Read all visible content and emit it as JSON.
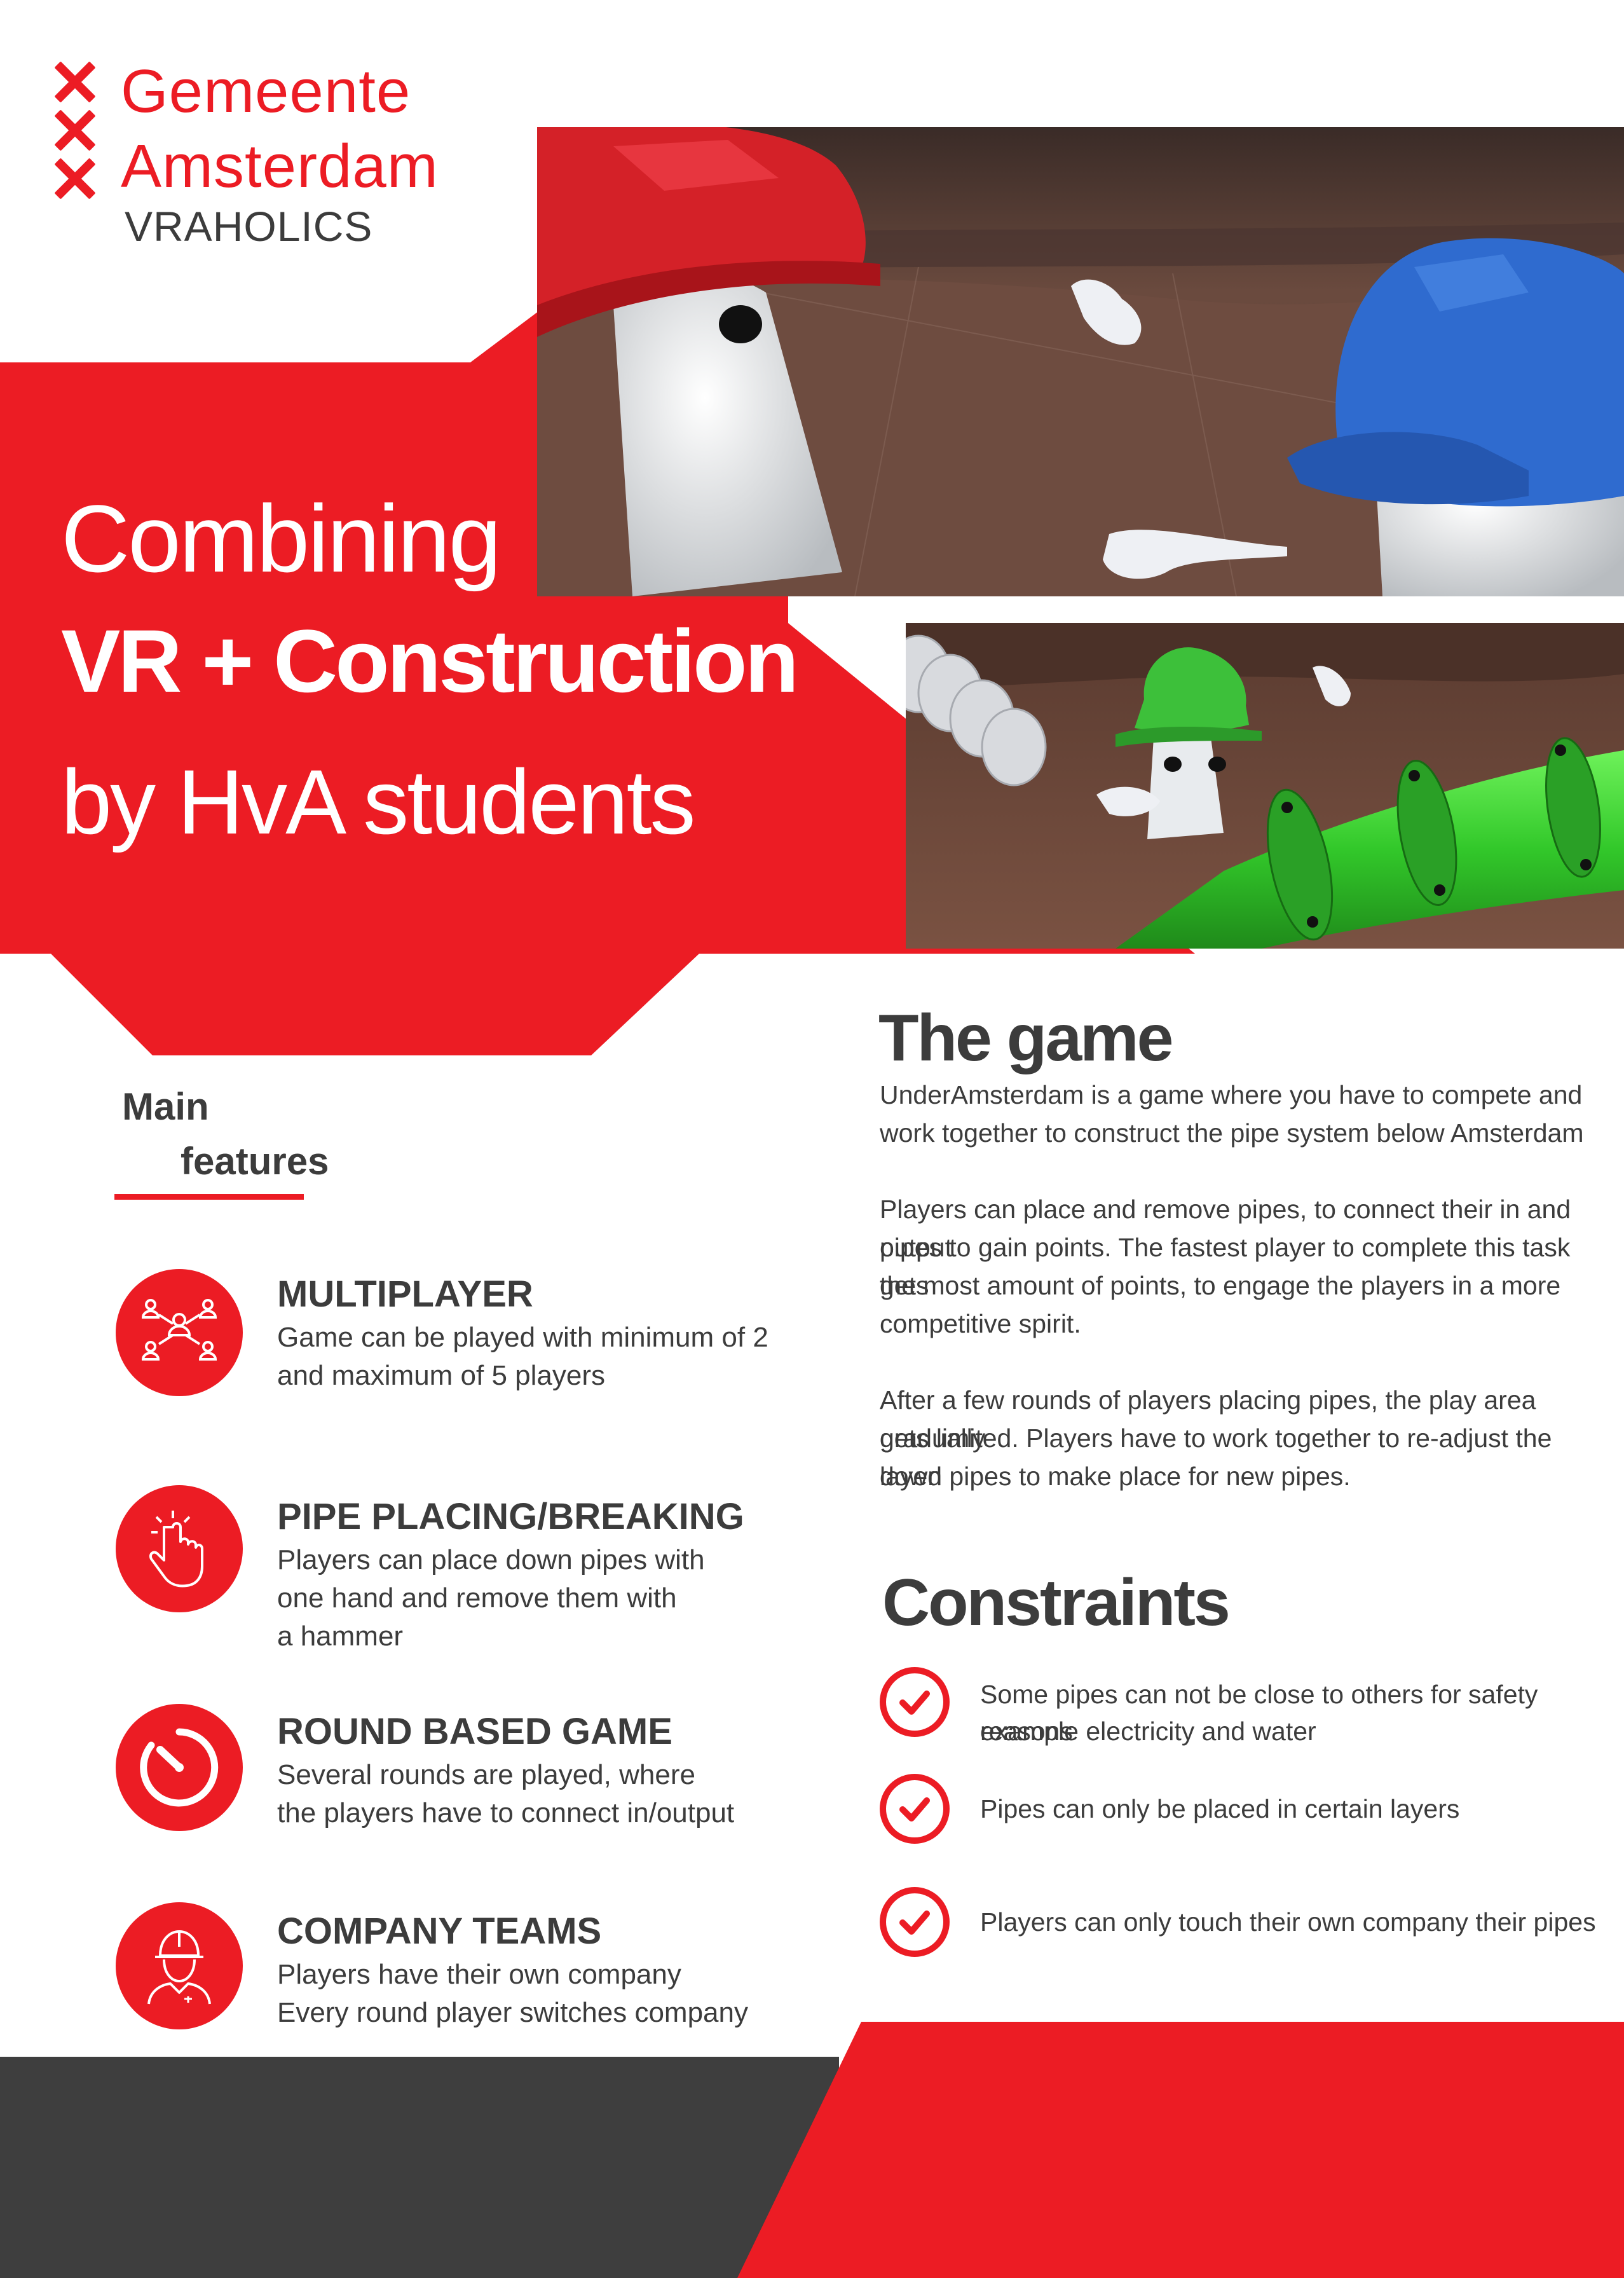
{
  "brand": {
    "logo_line1": "Gemeente",
    "logo_line2": "Amsterdam",
    "team": "VRAHOLICS",
    "accent_color": "#ec1c24",
    "dark_color": "#3c3c3c"
  },
  "hero": {
    "line1": "Combining",
    "line2": "VR + Construction",
    "line3": "by HvA students"
  },
  "features": {
    "heading_line1": "Main",
    "heading_line2": "features",
    "items": [
      {
        "icon": "people-network-icon",
        "title": "MULTIPLAYER",
        "desc_line1": "Game can be played with minimum of 2",
        "desc_line2": "and maximum of 5 players",
        "desc_line3": ""
      },
      {
        "icon": "hand-tap-icon",
        "title": "PIPE PLACING/BREAKING",
        "desc_line1": "Players can place down pipes with",
        "desc_line2": "one hand and remove them with",
        "desc_line3": "a hammer"
      },
      {
        "icon": "timer-gauge-icon",
        "title": "ROUND BASED GAME",
        "desc_line1": "Several rounds are played, where",
        "desc_line2": "the players have to connect in/output",
        "desc_line3": ""
      },
      {
        "icon": "worker-helmet-icon",
        "title": "COMPANY TEAMS",
        "desc_line1": "Players have their own company",
        "desc_line2": "Every round player switches company",
        "desc_line3": ""
      }
    ]
  },
  "game": {
    "heading": "The game",
    "p1_l1": "UnderAmsterdam is a game where you have to compete and",
    "p1_l2": "work together to construct the pipe system below Amsterdam",
    "p2_l1": "Players can place and remove pipes, to connect their in and output",
    "p2_l2": "pipes to gain points. The fastest player to complete this task gets",
    "p2_l3": "the most amount of points, to engage the players in a more",
    "p2_l4": "competitive spirit.",
    "p3_l1": "After a few rounds of players placing pipes, the play area gradually",
    "p3_l2": "gets limited.  Players have to work together to re-adjust the layed",
    "p3_l3": "down pipes to make place for new pipes."
  },
  "constraints": {
    "heading": "Constraints",
    "items": [
      {
        "line1": "Some pipes can not be close to others for safety reasons",
        "line2": "example electricity and water"
      },
      {
        "line1": "Pipes can only be placed in certain layers",
        "line2": ""
      },
      {
        "line1": "Players can only touch their own company their pipes",
        "line2": ""
      }
    ]
  }
}
